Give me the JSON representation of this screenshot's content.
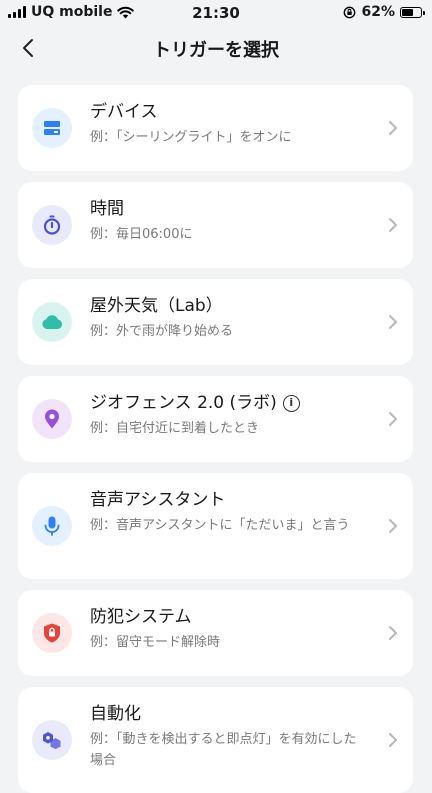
{
  "status_bar": {
    "carrier": "UQ mobile",
    "time": "21:30",
    "battery_percent": "62%",
    "battery_level": 0.62
  },
  "header": {
    "title": "トリガーを選択",
    "back_icon": "chevron-left-icon"
  },
  "triggers": [
    {
      "title": "デバイス",
      "subtitle": "例：「シーリングライト」をオンに",
      "icon": "device-icon",
      "icon_bg": "#e3f0ff",
      "icon_color": "#2d7ff9"
    },
    {
      "title": "時間",
      "subtitle": "例：毎日06:00に",
      "icon": "timer-icon",
      "icon_bg": "#e8eafc",
      "icon_color": "#4a52d6"
    },
    {
      "title": "屋外天気（Lab）",
      "subtitle": "例：外で雨が降り始める",
      "icon": "cloud-icon",
      "icon_bg": "#d9f4ef",
      "icon_color": "#2fbfa8"
    },
    {
      "title": "ジオフェンス 2.0 (ラボ)",
      "subtitle": "例：自宅付近に到着したとき",
      "icon": "location-pin-icon",
      "icon_bg": "#f0e4fa",
      "icon_color": "#9b4fd6"
    },
    {
      "title": "音声アシスタント",
      "subtitle": "例：音声アシスタントに「ただいま」と言う",
      "icon": "microphone-icon",
      "icon_bg": "#e3f0ff",
      "icon_color": "#2d7ff9"
    },
    {
      "title": "防犯システム",
      "subtitle": "例：留守モード解除時",
      "icon": "shield-lock-icon",
      "icon_bg": "#fde6e6",
      "icon_color": "#e8413c"
    },
    {
      "title": "自動化",
      "subtitle": "例：「動きを検出すると即点灯」を有効にした場合",
      "icon": "automation-icon",
      "icon_bg": "#e8eafc",
      "icon_color": "#4a52d6"
    }
  ]
}
